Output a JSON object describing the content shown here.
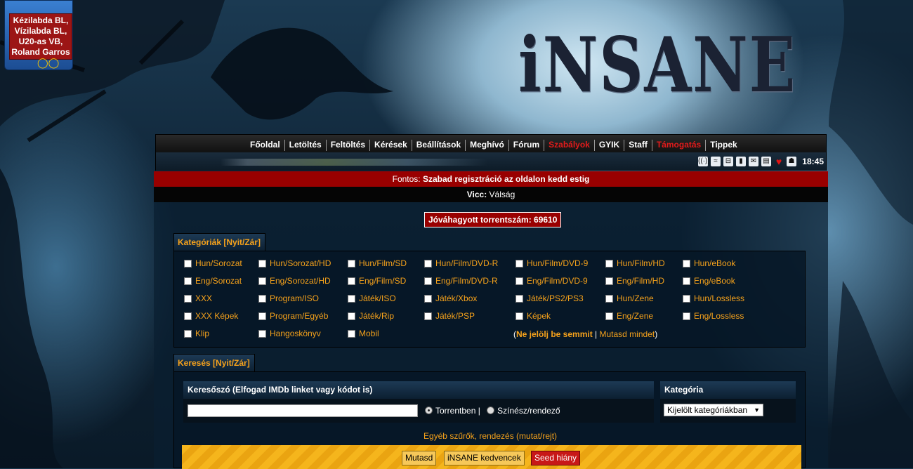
{
  "promo": {
    "text": "Kézilabda BL, Vízilabda BL, U20-as VB, Roland Garros"
  },
  "logo": "iNSANE",
  "nav": {
    "links": [
      {
        "label": "Főoldal",
        "highlight": false
      },
      {
        "label": "Letöltés",
        "highlight": false
      },
      {
        "label": "Feltöltés",
        "highlight": false
      },
      {
        "label": "Kérések",
        "highlight": false
      },
      {
        "label": "Beállítások",
        "highlight": false
      },
      {
        "label": "Meghívó",
        "highlight": false
      },
      {
        "label": "Fórum",
        "highlight": false
      },
      {
        "label": "Szabályok",
        "highlight": true
      },
      {
        "label": "GYIK",
        "highlight": false
      },
      {
        "label": "Staff",
        "highlight": false
      },
      {
        "label": "Támogatás",
        "highlight": true
      },
      {
        "label": "Tippek",
        "highlight": false
      }
    ],
    "icons": [
      "rss-radio-icon",
      "rss-feed-icon",
      "cart-icon",
      "bookmark-icon",
      "mail-icon",
      "message-icon",
      "heart-icon",
      "profile-icon"
    ],
    "clock": "18:45"
  },
  "alert": {
    "prefix": "Fontos:",
    "text": "Szabad regisztráció az oldalon kedd estig"
  },
  "joke": {
    "prefix": "Vicc:",
    "text": "Válság"
  },
  "torrent_count": "Jóváhagyott torrentszám: 69610",
  "categories": {
    "tab_label": "Kategóriák [Nyit/Zár]",
    "rows": [
      [
        "Hun/Sorozat",
        "Hun/Sorozat/HD",
        "Hun/Film/SD",
        "Hun/Film/DVD-R",
        "Hun/Film/DVD-9",
        "Hun/Film/HD",
        "Hun/eBook"
      ],
      [
        "Eng/Sorozat",
        "Eng/Sorozat/HD",
        "Eng/Film/SD",
        "Eng/Film/DVD-R",
        "Eng/Film/DVD-9",
        "Eng/Film/HD",
        "Eng/eBook"
      ],
      [
        "XXX",
        "Program/ISO",
        "Játék/ISO",
        "Játék/Xbox",
        "Játék/PS2/PS3",
        "Hun/Zene",
        "Hun/Lossless"
      ],
      [
        "XXX Képek",
        "Program/Egyéb",
        "Játék/Rip",
        "Játék/PSP",
        "Képek",
        "Eng/Zene",
        "Eng/Lossless"
      ],
      [
        "Klip",
        "Hangoskönyv",
        "Mobil"
      ]
    ],
    "select_none": "Ne jelölj be semmit",
    "show_all": "Mutasd mindet"
  },
  "search": {
    "tab_label": "Keresés [Nyit/Zár]",
    "keyword_header": "Keresőszó (Elfogad IMDb linket vagy kódot is)",
    "keyword_value": "",
    "option_torrent": "Torrentben |",
    "option_actor": "Színész/rendező",
    "category_header": "Kategória",
    "category_selected": "Kijelölt kategóriákban",
    "filters_link": "Egyéb szűrők, rendezés (mutat/rejt)",
    "buttons": {
      "show": "Mutasd",
      "favorites": "iNSANE kedvencek",
      "seed": "Seed hiány"
    }
  },
  "colors": {
    "accent_orange": "#f6a21b",
    "alert_red": "#990000",
    "nav_red": "#e21b1b"
  }
}
